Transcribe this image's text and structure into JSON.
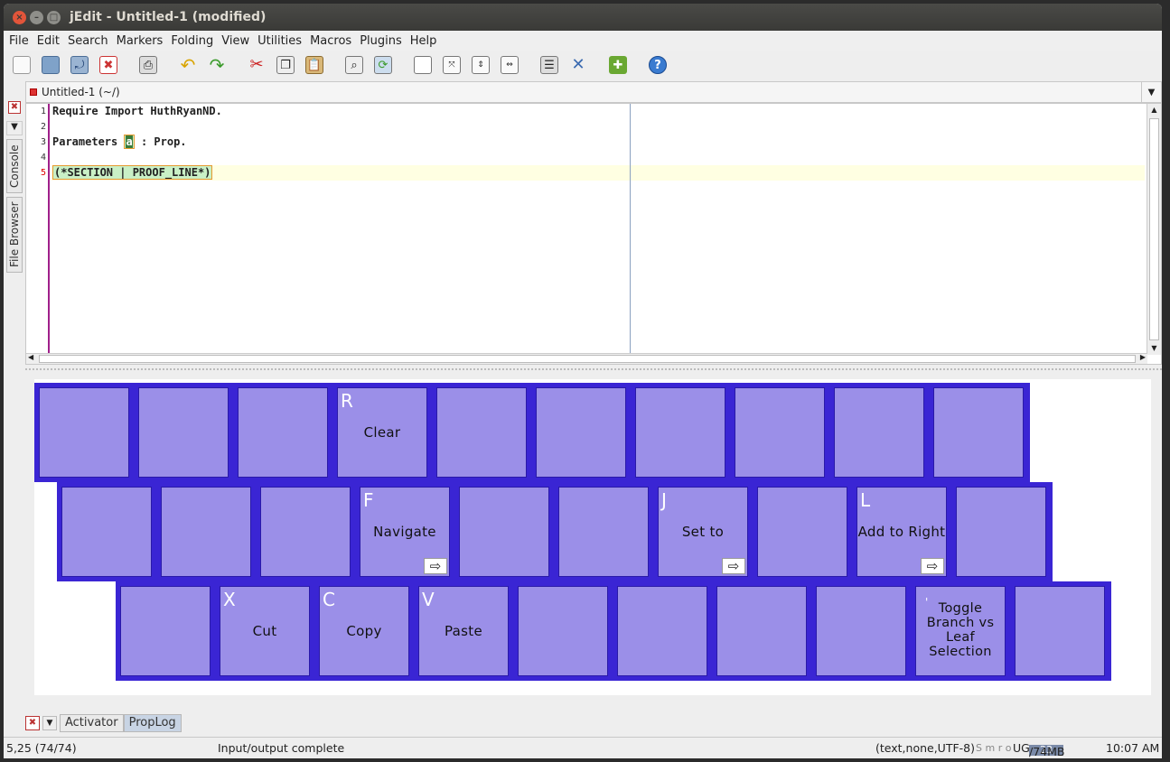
{
  "window": {
    "title": "jEdit - Untitled-1 (modified)"
  },
  "menu": [
    "File",
    "Edit",
    "Search",
    "Markers",
    "Folding",
    "View",
    "Utilities",
    "Macros",
    "Plugins",
    "Help"
  ],
  "toolbar_icons": [
    "new-file-icon",
    "open-file-icon",
    "reload-icon",
    "close-file-icon",
    "print-icon",
    "undo-icon",
    "redo-icon",
    "cut-icon",
    "copy-icon",
    "paste-icon",
    "find-icon",
    "find-replace-icon",
    "new-view-icon",
    "split-horizontal-icon",
    "split-vertical-icon",
    "unsplit-icon",
    "global-options-icon",
    "plugin-options-icon",
    "plugin-manager-icon",
    "help-icon"
  ],
  "buffer": {
    "name": "Untitled-1 (~/)"
  },
  "left_dock": {
    "tabs": [
      "Console",
      "File Browser"
    ]
  },
  "editor": {
    "line_numbers": [
      "1",
      "2",
      "3",
      "4",
      "5"
    ],
    "current_line": "5",
    "lines": {
      "l1": "Require Import HuthRyanND.",
      "l3_a": "Parameters",
      "l3_b": "a",
      "l3_c": " : Prop.",
      "l5": "(*SECTION | PROOF_LINE*)"
    }
  },
  "keyboard": {
    "row1": [
      {
        "letter": "",
        "label": ""
      },
      {
        "letter": "",
        "label": ""
      },
      {
        "letter": "",
        "label": ""
      },
      {
        "letter": "R",
        "label": "Clear"
      },
      {
        "letter": "",
        "label": ""
      },
      {
        "letter": "",
        "label": ""
      },
      {
        "letter": "",
        "label": ""
      },
      {
        "letter": "",
        "label": ""
      },
      {
        "letter": "",
        "label": ""
      },
      {
        "letter": "",
        "label": ""
      }
    ],
    "row2": [
      {
        "letter": "",
        "label": ""
      },
      {
        "letter": "",
        "label": ""
      },
      {
        "letter": "",
        "label": ""
      },
      {
        "letter": "F",
        "label": "Navigate",
        "arrow": "⇨"
      },
      {
        "letter": "",
        "label": ""
      },
      {
        "letter": "",
        "label": ""
      },
      {
        "letter": "J",
        "label": "Set to",
        "arrow": "⇨"
      },
      {
        "letter": "",
        "label": ""
      },
      {
        "letter": "L",
        "label": "Add to Right",
        "arrow": "⇨"
      },
      {
        "letter": "",
        "label": ""
      }
    ],
    "row3": [
      {
        "letter": "",
        "label": ""
      },
      {
        "letter": "X",
        "label": "Cut"
      },
      {
        "letter": "C",
        "label": "Copy"
      },
      {
        "letter": "V",
        "label": "Paste"
      },
      {
        "letter": "",
        "label": ""
      },
      {
        "letter": "",
        "label": ""
      },
      {
        "letter": "",
        "label": ""
      },
      {
        "letter": "",
        "label": ""
      },
      {
        "letter": "'",
        "label": "Toggle Branch vs Leaf Selection",
        "multiline": [
          "Toggle",
          "Branch vs",
          "Leaf",
          "Selection"
        ]
      },
      {
        "letter": "",
        "label": ""
      }
    ]
  },
  "bottom_dock": {
    "tabs": [
      "Activator",
      "PropLog"
    ],
    "active_tab": "PropLog"
  },
  "status": {
    "caret": "5,25 (74/74)",
    "message": "Input/output complete",
    "mode": "(text,none,UTF-8)",
    "flags": "S m r o",
    "flags2": "UG",
    "memory_used": "23",
    "memory_total": "/74MB",
    "time": "10:07 AM"
  },
  "colors": {
    "key_bg": "#9b8fe8",
    "keyboard_frame": "#3a25d4",
    "gutter_accent": "#a0208a"
  }
}
